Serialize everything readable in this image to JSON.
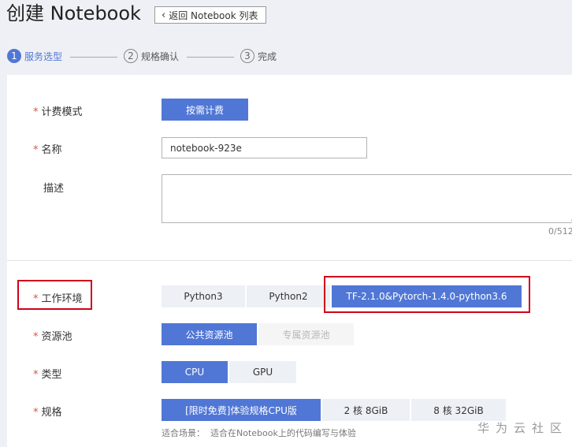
{
  "header": {
    "title": "创建 Notebook",
    "back_label": "返回 Notebook 列表"
  },
  "steps": [
    {
      "num": "1",
      "label": "服务选型",
      "state": "active"
    },
    {
      "num": "2",
      "label": "规格确认",
      "state": "inactive"
    },
    {
      "num": "3",
      "label": "完成",
      "state": "inactive"
    }
  ],
  "form": {
    "billing": {
      "label": "计费模式",
      "required": "*",
      "option": "按需计费"
    },
    "name": {
      "label": "名称",
      "required": "*",
      "value": "notebook-923e"
    },
    "description": {
      "label": "描述",
      "value": "",
      "counter": "0/512"
    },
    "environment": {
      "label": "工作环境",
      "required": "*",
      "options": [
        "Python3",
        "Python2",
        "TF-2.1.0&Pytorch-1.4.0-python3.6"
      ],
      "selected": "TF-2.1.0&Pytorch-1.4.0-python3.6"
    },
    "pool": {
      "label": "资源池",
      "required": "*",
      "options": [
        "公共资源池",
        "专属资源池"
      ],
      "selected": "公共资源池"
    },
    "type": {
      "label": "类型",
      "required": "*",
      "options": [
        "CPU",
        "GPU"
      ],
      "selected": "CPU"
    },
    "spec": {
      "label": "规格",
      "required": "*",
      "options": [
        "[限时免费]体验规格CPU版",
        "2 核 8GiB",
        "8 核 32GiB"
      ],
      "selected": "[限时免费]体验规格CPU版",
      "hint_label": "适合场景：",
      "hint_text": "适合在Notebook上的代码编写与体验"
    }
  },
  "watermark": "华为云社区",
  "colors": {
    "accent": "#5077d5",
    "highlight": "#d0021b",
    "required": "#e5503a"
  }
}
